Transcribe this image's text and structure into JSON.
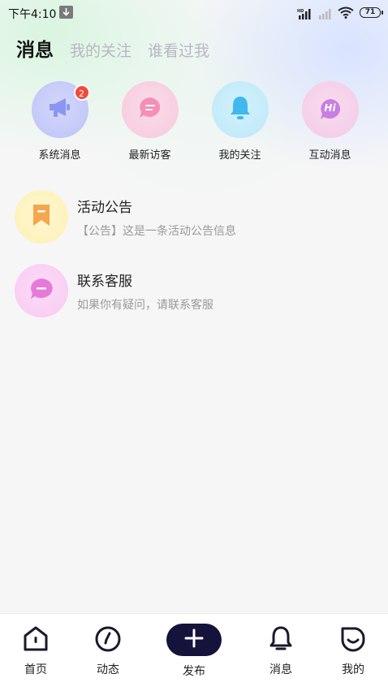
{
  "status_bar": {
    "time": "下午4:10",
    "battery": "71",
    "network_label": "HD"
  },
  "tabs": [
    {
      "label": "消息",
      "active": true
    },
    {
      "label": "我的关注",
      "active": false
    },
    {
      "label": "谁看过我",
      "active": false
    }
  ],
  "quick_actions": [
    {
      "label": "系统消息",
      "icon": "megaphone-icon",
      "badge": "2"
    },
    {
      "label": "最新访客",
      "icon": "chat-bubble-icon"
    },
    {
      "label": "我的关注",
      "icon": "bell-icon"
    },
    {
      "label": "互动消息",
      "icon": "hi-bubble-icon",
      "icon_text": "Hi"
    }
  ],
  "list": [
    {
      "title": "活动公告",
      "subtitle": "【公告】这是一条活动公告信息",
      "icon": "bookmark-icon"
    },
    {
      "title": "联系客服",
      "subtitle": "如果你有疑问，请联系客服",
      "icon": "message-icon"
    }
  ],
  "bottom_nav": [
    {
      "label": "首页",
      "icon": "home-icon"
    },
    {
      "label": "动态",
      "icon": "compass-icon"
    },
    {
      "label": "发布",
      "icon": "plus-icon"
    },
    {
      "label": "消息",
      "icon": "message-bell-icon"
    },
    {
      "label": "我的",
      "icon": "profile-icon"
    }
  ],
  "colors": {
    "accent_dark": "#15133b",
    "badge_red": "#f04a3c",
    "tab_inactive": "#b7b7c4"
  }
}
